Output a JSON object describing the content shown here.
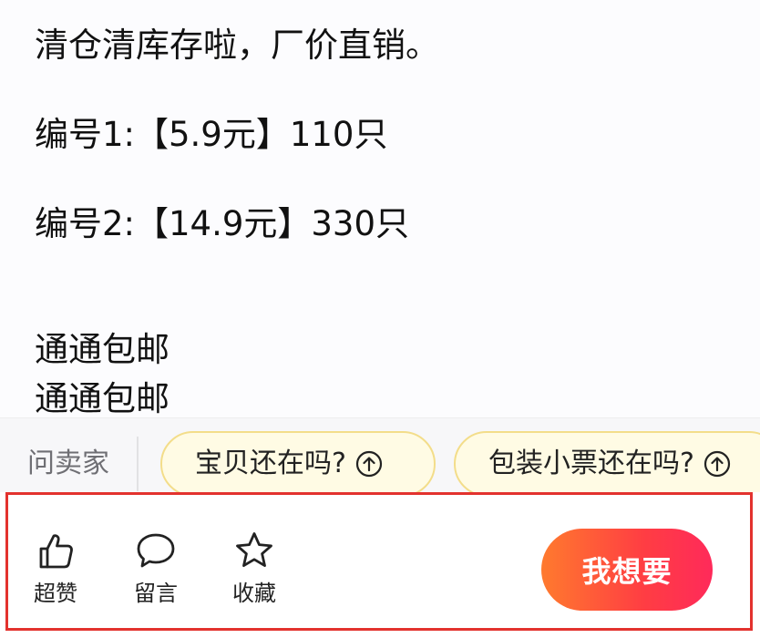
{
  "description": {
    "lines": [
      "清仓清库存啦，厂价直销。",
      "编号1:【5.9元】110只",
      "编号2:【14.9元】330只",
      "通通包邮",
      "通通包邮"
    ]
  },
  "quick_ask": {
    "label": "问卖家",
    "chips": [
      {
        "text": "宝贝还在吗?",
        "icon": "arrow-up-circle-icon"
      },
      {
        "text": "包装小票还在吗?",
        "icon": "arrow-up-circle-icon"
      }
    ]
  },
  "action_bar": {
    "like": {
      "label": "超赞",
      "icon": "thumbs-up-icon"
    },
    "comment": {
      "label": "留言",
      "icon": "speech-bubble-icon"
    },
    "favorite": {
      "label": "收藏",
      "icon": "star-icon"
    },
    "want_button": {
      "label": "我想要"
    }
  },
  "colors": {
    "highlight_border": "#e3322e",
    "chip_background": "#fffbe4",
    "chip_border": "#f3dd8a",
    "want_gradient_start": "#ff7a2e",
    "want_gradient_end": "#ff2a5a"
  }
}
